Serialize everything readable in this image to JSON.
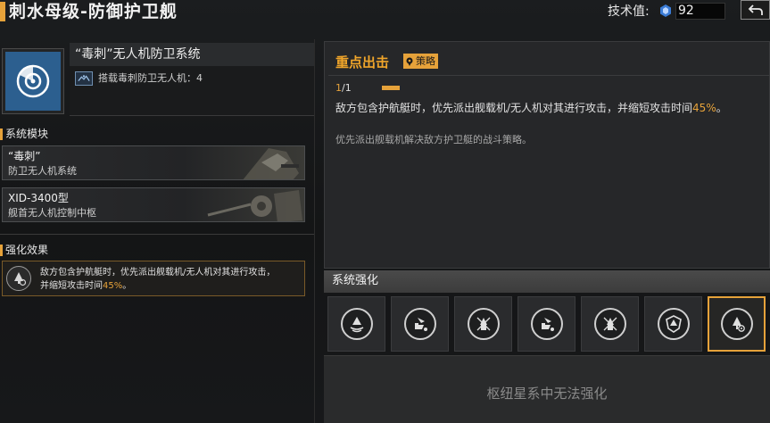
{
  "header": {
    "title": "刺水母级-防御护卫舰",
    "tech_label": "技术值:",
    "tech_value": "92",
    "close_icon": "return-arrow-icon"
  },
  "system": {
    "icon": "radar-target-icon",
    "name": "“毒刺”无人机防卫系统",
    "drone_icon": "drone-carrier-icon",
    "drone_text": "搭载毒刺防卫无人机：4"
  },
  "modules": {
    "title": "系统模块",
    "items": [
      {
        "name": "“毒刺”",
        "sub": "防卫无人机系统"
      },
      {
        "name": "XID-3400型",
        "sub": "舰首无人机控制中枢"
      }
    ]
  },
  "effect": {
    "title": "强化效果",
    "icon": "ship-enhance-icon",
    "text_main": "敌方包含护航艇时，优先派出舰载机/无人机对其进行攻击，",
    "text_second": "并缩短攻击时间",
    "highlight": "45%",
    "text_end": "。"
  },
  "strategy": {
    "title": "重点出击",
    "badge": "策略",
    "badge_icon": "pin-icon",
    "counter_current": "1",
    "counter_total": "/1",
    "progress": 1.0,
    "text_main": "敌方包含护航艇时，优先派出舰载机/无人机对其进行攻击，并缩短攻击时间",
    "highlight": "45%",
    "text_end": "。",
    "desc": "优先派出舰载机解决敌方护卫艇的战斗策略。"
  },
  "enhance": {
    "title": "系统强化",
    "slots": [
      {
        "icon": "ship-wave-icon",
        "selected": false
      },
      {
        "icon": "ship-hand-icon",
        "selected": false
      },
      {
        "icon": "ship-cross-icon",
        "selected": false
      },
      {
        "icon": "ship-hand-icon",
        "selected": false
      },
      {
        "icon": "ship-cross-icon",
        "selected": false
      },
      {
        "icon": "ship-shield-icon",
        "selected": false
      },
      {
        "icon": "ship-target-icon",
        "selected": true
      }
    ],
    "note": "枢纽星系中无法强化"
  },
  "colors": {
    "accent": "#e6a23a",
    "icon_blue": "#2c5f8f"
  }
}
